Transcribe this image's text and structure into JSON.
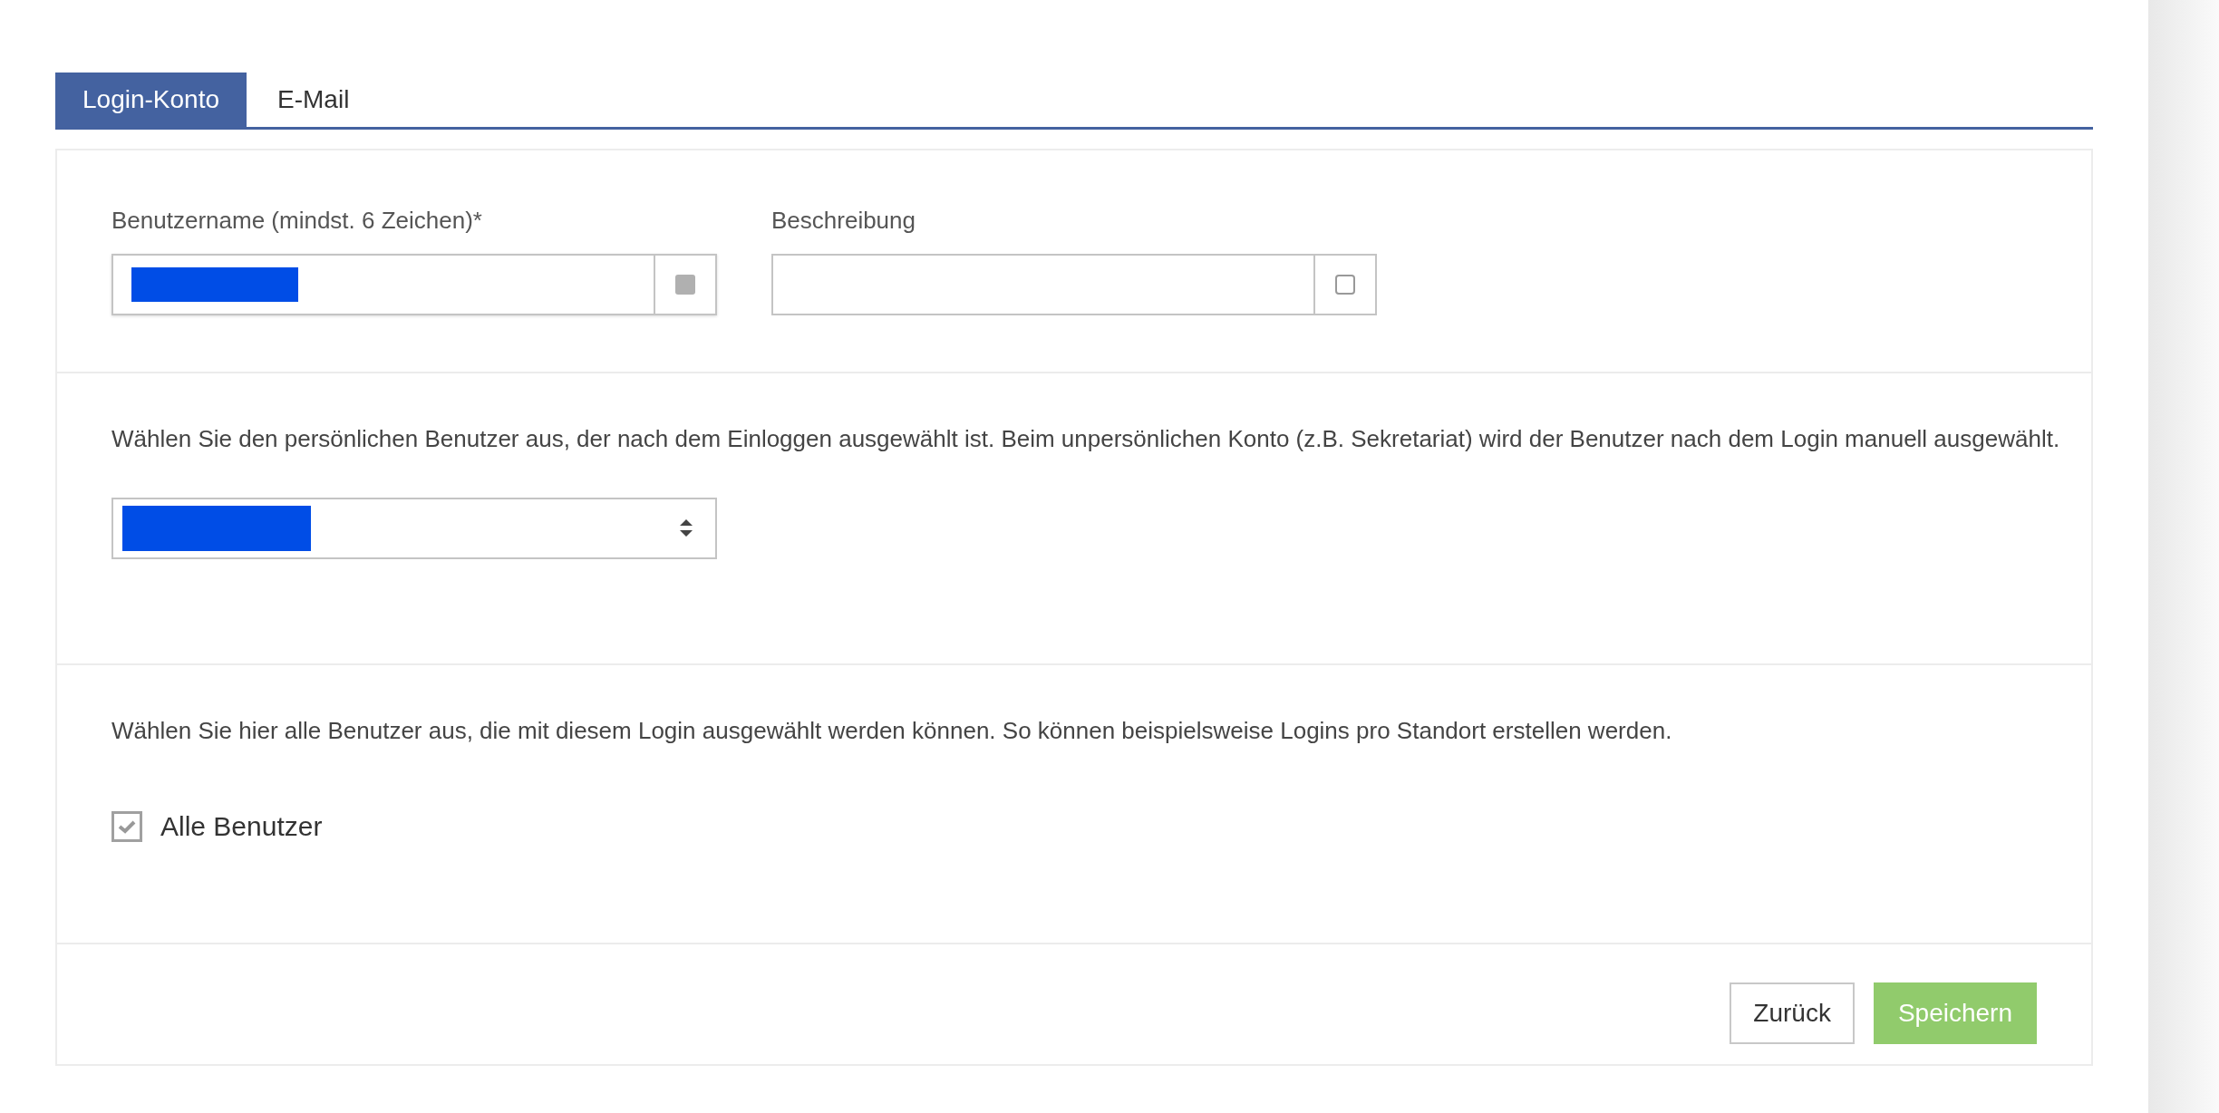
{
  "tabs": [
    {
      "label": "Login-Konto",
      "selected": true
    },
    {
      "label": "E-Mail",
      "selected": false
    }
  ],
  "fields": [
    {
      "label": "Benutzername (mindst. 6 Zeichen)*",
      "redacted": true,
      "addon_filled": true
    },
    {
      "label": "Beschreibung",
      "redacted": false,
      "addon_filled": false
    }
  ],
  "personal_user": {
    "text": "Wählen Sie den persönlichen Benutzer aus, der nach dem Einloggen ausgewählt ist. Beim unpersönlichen Konto (z.B. Sekretariat) wird der Benutzer nach dem Login manuell ausgewählt.",
    "select_redacted": true
  },
  "allowed_users": {
    "text": "Wählen Sie hier alle Benutzer aus, die mit diesem Login ausgewählt werden können. So können beispielsweise Logins pro Standort erstellen werden.",
    "options": [
      {
        "label": "Alle Benutzer",
        "checked": true
      }
    ]
  },
  "buttons": [
    {
      "label": "Zurück",
      "kind": "secondary"
    },
    {
      "label": "Speichern",
      "kind": "primary"
    }
  ]
}
